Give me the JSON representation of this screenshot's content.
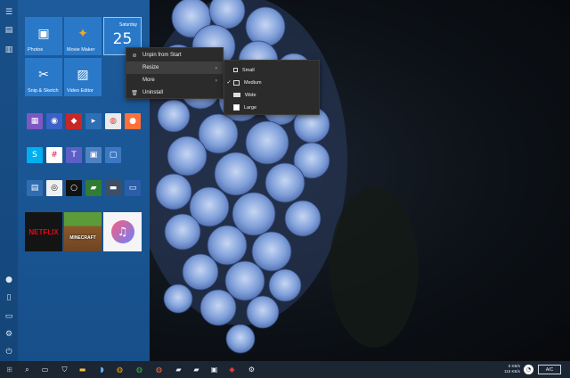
{
  "start_menu": {
    "tiles": {
      "photos": "Photos",
      "movie_maker": "Movie Maker",
      "calendar_day": "Saturday",
      "calendar_date": "25",
      "snip_sketch": "Snip & Sketch",
      "video_editor": "Video Editor",
      "netflix": "NETFLIX",
      "minecraft": "MINECRAFT"
    }
  },
  "context_menu": {
    "unpin": "Unpin from Start",
    "resize": "Resize",
    "more": "More",
    "uninstall": "Uninstall"
  },
  "resize_submenu": {
    "small": "Small",
    "medium": "Medium",
    "wide": "Wide",
    "large": "Large",
    "selected": "Medium"
  },
  "taskbar": {
    "network_up": "5 KB/s",
    "network_down": "116 KB/s",
    "ime": "A/C"
  },
  "colors": {
    "start_bg": "#1d5b9c",
    "tile_blue": "#2a79c9",
    "taskbar": "#1c2633"
  }
}
